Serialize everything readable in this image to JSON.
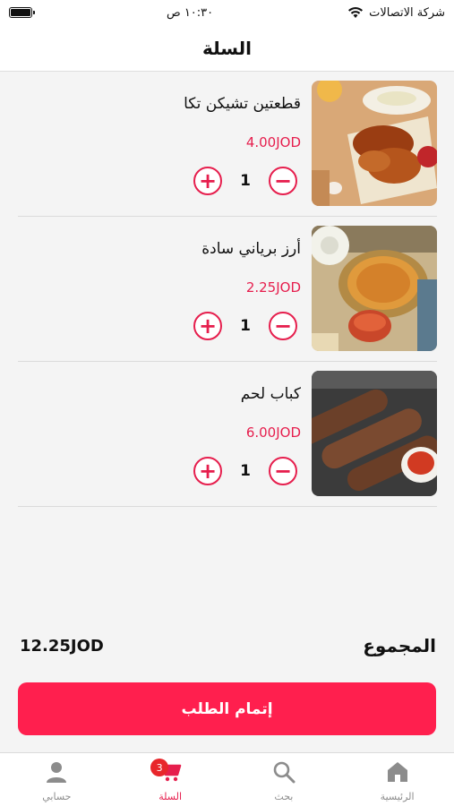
{
  "status_bar": {
    "carrier": "شركة الاتصالات",
    "time": "١٠:٣٠ ص"
  },
  "header": {
    "title": "السلة"
  },
  "cart": {
    "items": [
      {
        "name": "قطعتين تشيكن تكا",
        "price": "4.00JOD",
        "quantity": "1",
        "image": "chicken-tikka-photo"
      },
      {
        "name": "أرز برياني سادة",
        "price": "2.25JOD",
        "quantity": "1",
        "image": "biryani-rice-photo"
      },
      {
        "name": "كباب لحم",
        "price": "6.00JOD",
        "quantity": "1",
        "image": "meat-kebab-photo"
      }
    ],
    "increment_symbol": "+",
    "decrement_symbol": "−"
  },
  "total": {
    "label": "المجموع",
    "amount": "12.25JOD"
  },
  "checkout": {
    "label": "إتمام الطلب"
  },
  "nav": {
    "items": [
      {
        "label": "الرئيسية",
        "icon": "home-icon"
      },
      {
        "label": "بحث",
        "icon": "search-icon"
      },
      {
        "label": "السلة",
        "icon": "cart-icon",
        "badge": "3",
        "active": true
      },
      {
        "label": "حسابي",
        "icon": "user-icon"
      }
    ]
  },
  "colors": {
    "accent": "#e61e4d",
    "checkout": "#ff1f4e",
    "badge": "#e8262b",
    "background": "#f4f4f4"
  }
}
